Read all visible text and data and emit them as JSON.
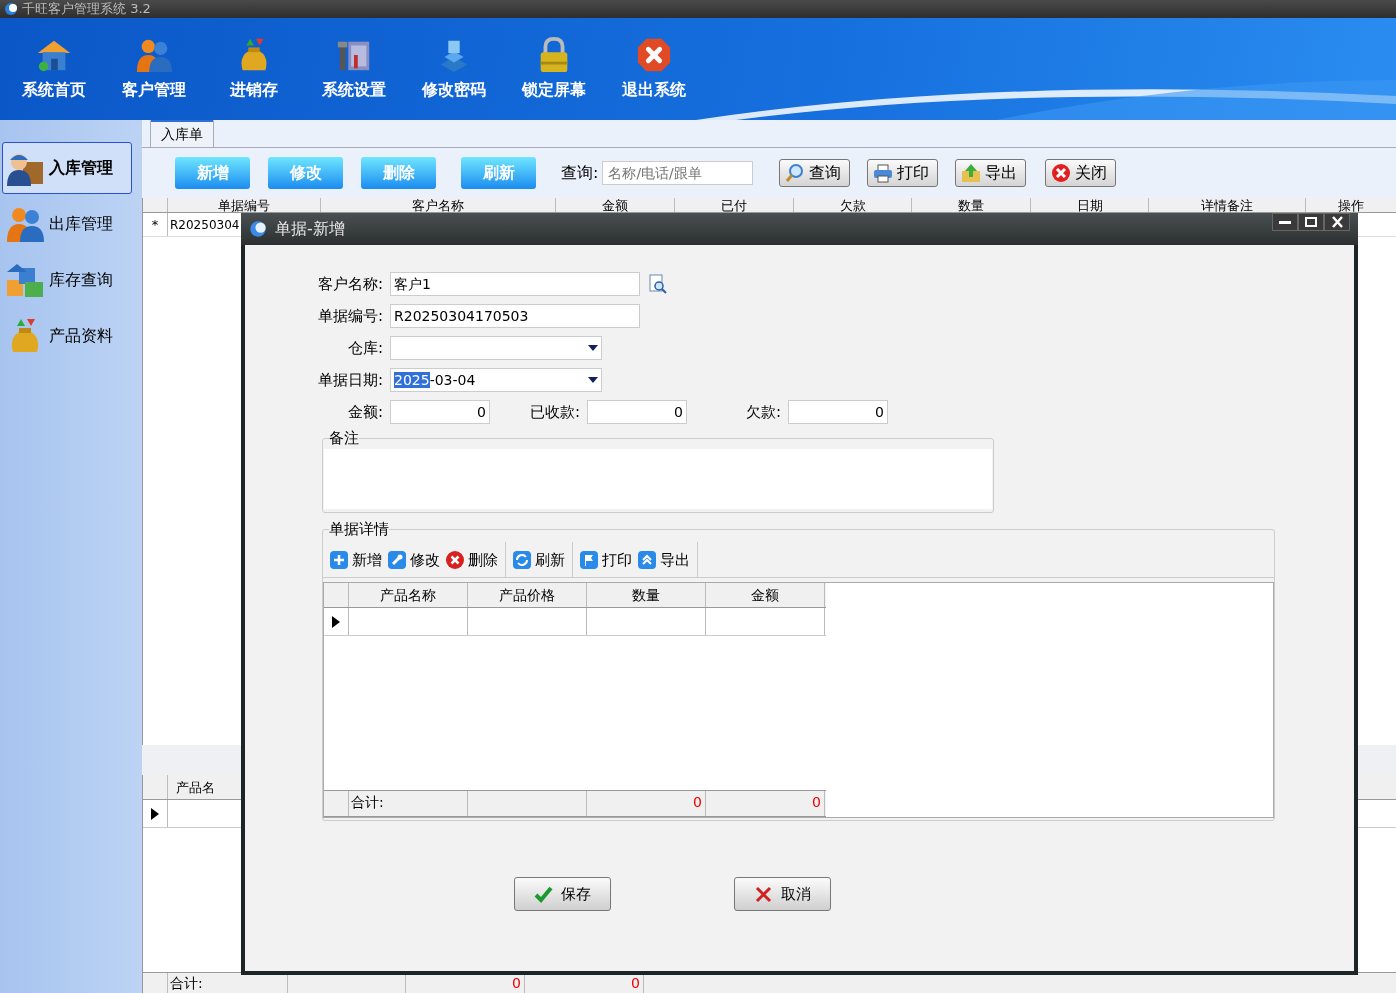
{
  "window": {
    "title": "千旺客户管理系统 3.2"
  },
  "main_menu": [
    {
      "label": "系统首页"
    },
    {
      "label": "客户管理"
    },
    {
      "label": "进销存"
    },
    {
      "label": "系统设置"
    },
    {
      "label": "修改密码"
    },
    {
      "label": "锁定屏幕"
    },
    {
      "label": "退出系统"
    }
  ],
  "sidebar": {
    "items": [
      {
        "label": "入库管理",
        "selected": true
      },
      {
        "label": "出库管理",
        "selected": false
      },
      {
        "label": "库存查询",
        "selected": false
      },
      {
        "label": "产品资料",
        "selected": false
      }
    ]
  },
  "tabs": [
    {
      "label": "入库单",
      "selected": true
    }
  ],
  "toolbar": {
    "action_buttons": [
      "新增",
      "修改",
      "删除",
      "刷新"
    ],
    "search_label": "查询:",
    "search": {
      "placeholder": "名称/电话/跟单"
    },
    "buttons": [
      "查询",
      "打印",
      "导出",
      "关闭"
    ]
  },
  "order_table": {
    "columns": [
      "单据编号",
      "客户名称",
      "金额",
      "已付",
      "欠款",
      "数量",
      "日期",
      "详情备注",
      "操作"
    ],
    "rows": [
      {
        "marker": "*",
        "cells": [
          "R20250304"
        ]
      }
    ]
  },
  "detail_table": {
    "columns": [
      "产品名"
    ],
    "current_row": true,
    "footer": {
      "label": "合计:",
      "values": [
        "0",
        "0"
      ]
    }
  },
  "dialog": {
    "title": "单据-新增",
    "fields": [
      {
        "kind": "text",
        "label": "客户名称:",
        "value": "客户1",
        "lookup": true
      },
      {
        "kind": "text",
        "label": "单据编号:",
        "value": "R20250304170503",
        "lookup": false
      },
      {
        "kind": "select",
        "label": "仓库:"
      },
      {
        "kind": "select",
        "label": "单据日期:",
        "selected_part": "2025",
        "value": "-03-04"
      }
    ],
    "amounts": [
      {
        "label": "金额:",
        "value": "0"
      },
      {
        "label": "已收款:",
        "value": "0"
      },
      {
        "label": "欠款:",
        "value": "0"
      }
    ],
    "remarks": {
      "legend": "备注"
    },
    "details": {
      "legend": "单据详情",
      "toolbar_groups": [
        [
          "新增",
          "修改",
          "删除"
        ],
        [
          "刷新"
        ],
        [
          "打印",
          "导出"
        ]
      ],
      "columns": [
        "产品名称",
        "产品价格",
        "数量",
        "金额"
      ],
      "current_row": true,
      "footer": {
        "label": "合计:",
        "values": [
          "0",
          "0"
        ]
      }
    },
    "buttons": [
      "保存",
      "取消"
    ]
  }
}
